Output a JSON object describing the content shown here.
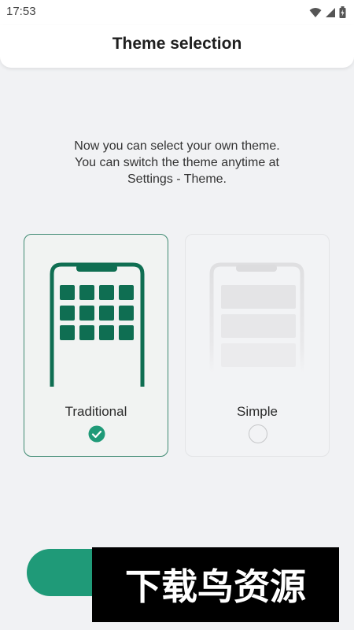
{
  "status_bar": {
    "time": "17:53"
  },
  "header": {
    "title": "Theme selection"
  },
  "intro": {
    "lines": [
      "Now you can select your own theme.",
      "You can switch the theme anytime at",
      "Settings - Theme."
    ]
  },
  "themes": [
    {
      "label": "Traditional",
      "selected": true
    },
    {
      "label": "Simple",
      "selected": false
    }
  ],
  "colors": {
    "accent": "#1f9a78",
    "icon_green": "#0f6e52",
    "background": "#f1f2f4"
  },
  "watermark": {
    "text": "下载鸟资源"
  }
}
